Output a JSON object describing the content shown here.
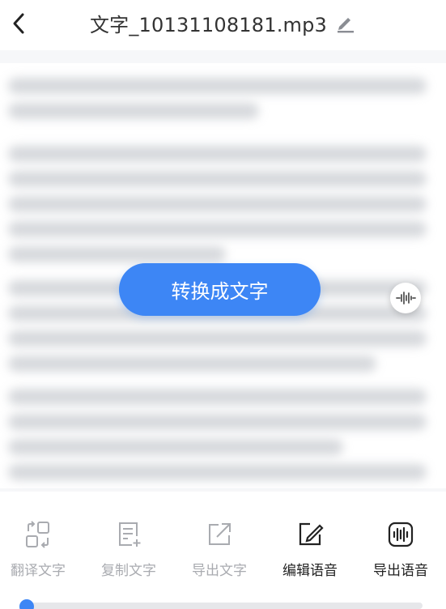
{
  "header": {
    "title": "文字_10131108181.mp3"
  },
  "main": {
    "convert_button_label": "转换成文字"
  },
  "toolbar": {
    "items": [
      {
        "label": "翻译文字",
        "icon": "translate-icon",
        "enabled": false
      },
      {
        "label": "复制文字",
        "icon": "copy-text-icon",
        "enabled": false
      },
      {
        "label": "导出文字",
        "icon": "export-text-icon",
        "enabled": false
      },
      {
        "label": "编辑语音",
        "icon": "edit-audio-icon",
        "enabled": true
      },
      {
        "label": "导出语音",
        "icon": "export-audio-icon",
        "enabled": true
      }
    ]
  },
  "playback": {
    "progress": 0.0
  },
  "colors": {
    "accent": "#3d86f5",
    "disabled": "#a9abb0",
    "text": "#333333"
  }
}
